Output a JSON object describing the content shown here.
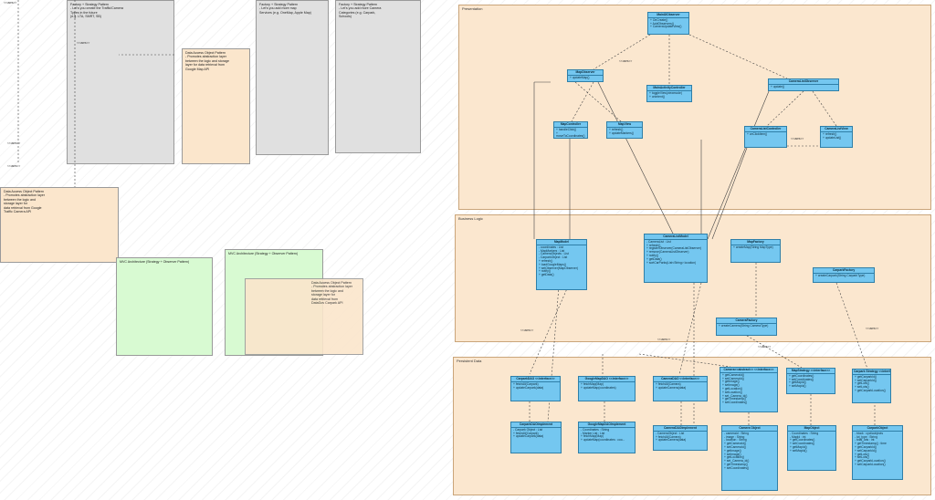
{
  "link_labels": {
    "top_left": "<<uses>>",
    "mid_left_1": "<<uses>>",
    "mid_left_2": "<<uses>>",
    "mid_left_3": "<<uses>>",
    "pres_1": "<<uses>>",
    "pres_2": "<<uses>>",
    "bl_1": "<<uses>>",
    "bl_2": "<<uses>>",
    "bl_3": "<<uses>>",
    "bl_4": "<<uses>>"
  },
  "notes": {
    "factory_1": "Factory + Strategy Pattern\n- Let's you create the Traffic/Camera\nTypes in the future\n(e.g. LTA, SMRT, SB)",
    "factory_2": "Factory + Strategy Pattern\n- Let's you add more map\nServices (e.g. OneMap, Apple Map)",
    "factory_3": "Factory + Strategy Pattern\n- Let's you add more Camera\nCategories (e.g. Carpark,\nSchools)",
    "dao_1": "Data Access Object Pattern\n- Promotes abstraction layer\nbetween the logic and storage\nlayer for data retrieval from\nGoogle Map API",
    "dao_2": "Data Access Object Pattern\n- Promotes abstraction layer\nbetween the logic and\nstorage layer for\ndata retrieval from Google\nTraffic Camera API",
    "dao_3": "Data Access Object Pattern\n- Promotes abstraction layer\nbetween the logic and\nstorage layer for\ndata retrieval from\nDataGov Carpark API",
    "mvc_1": "MVC Architecture (Strategy + Observer Pattern)",
    "mvc_2": "MVC Architecture (Strategy + Observer Pattern)"
  },
  "regions": {
    "presentation": "Presentation",
    "logic": "Business Logic",
    "persistent": "Persistent Data"
  },
  "classes": {
    "main_observer": {
      "name": "MainUIObserver",
      "body": "+ OnCreate()\n+ AddObservers()\n+ CameraUpdateView()"
    },
    "map_observer": {
      "name": "MapObserver",
      "body": "+ updateMap()"
    },
    "camlist_observer": {
      "name": "CameraListObserver",
      "body": "+ update()"
    },
    "mainactivity": {
      "name": "MainActivityController",
      "body": "+ toggleView(viewmode)\n+ onIntent()"
    },
    "map_controller": {
      "name": "MapController",
      "body": "+ handleClick()\n+ moveToCoordinates()"
    },
    "map_view": {
      "name": "MapView",
      "body": "+ refresh()\n+ updateMarkers()"
    },
    "camlist_controller": {
      "name": "CameraListController",
      "body": "+ onClickItem()"
    },
    "camlist_view": {
      "name": "CameraListView",
      "body": "+ refresh()\n+ updateList()"
    },
    "map_model": {
      "name": "MapModel",
      "body": "- coordinates : List\n- MapMarkers : List\n- CameraObjects : List\n- CarparkObject : List\n+ refresh()\n+ loadGoogleMaps()\n+ setObserver(MapObserver)\n+ notify()\n+ getData()"
    },
    "camlist_model": {
      "name": "CameraListModel",
      "body": "- CameraList : List\n+ refresh()\n+ registerObserver(CameraListObserver)\n+ remove(CameraListObserver)\n+ notify()\n+ getData()\n+ sortCarParks(List<String> location)"
    },
    "map_factory": {
      "name": "MapFactory",
      "body": "+ createMap(String MapType)"
    },
    "carpark_factory": {
      "name": "CarparkFactory",
      "body": "+ createCarpark(String CarparkType)"
    },
    "camera_factory": {
      "name": "CameraFactory",
      "body": "+ createCamera(String CameraType)"
    },
    "carpark_dao": {
      "name": "CarparkDAO <<interface>>",
      "body": "+ fetchAll(Carpark)\n+ updateCarpark(data)"
    },
    "googlemap_dao": {
      "name": "GoogleMapDAO <<interface>>",
      "body": "+ fetchMap(Map)\n+ updateMap(coordinates)"
    },
    "camera_dao": {
      "name": "CameraDAO <<interface>>",
      "body": "+ fetchAll(Camera)\n+ updateCamera(data)"
    },
    "camera_abstract": {
      "name": "Camera<<abstract>> <<interface>>",
      "body": "+ getCameraId()\n+ setCameraId()\n+ getImage()\n+ setImage()\n+ getLocation()\n+ setLocation()\n+ set_Camera_id()\n+ getTimestamp()\n+ setCoordinates()"
    },
    "map_strategy": {
      "name": "MapStrategy <<interface>>",
      "body": "+ getCoordinates()\n+ setCoordinates()\n+ getMapId()\n+ setMapId()"
    },
    "carpark_strategy": {
      "name": "Carpark Strategy <<interface>>",
      "body": "+ getCarparkId()\n+ setCarparkId()\n+ getLots()\n+ setLots()\n+ getCarparkLocation()"
    },
    "carpark_dao_impl": {
      "name": "CarparkDAOImplement",
      "body": "- Carpark Object : List\n+ fetchAll(Carpark)\n+ updateCarpark(data)"
    },
    "googlemap_dao_impl": {
      "name": "GoogleMapDAOImplement",
      "body": "- Coordinates : String\n- Marker List : List\n+ fetchMap(Map)\n+ updateMap(coordinates : coo..."
    },
    "camera_dao_impl": {
      "name": "CameraDAOImplement",
      "body": "- CameraObject : List\n+ fetchAll(Camera)\n+ updateCamera(data)"
    },
    "camera_object": {
      "name": "Camera Object",
      "body": "- cameraid : String\n- image : String\n- location : String\n+ getCameraId()\n+ setCameraId()\n+ getImage()\n+ setImage()\n+ getLocation()\n+ set_Camera_id()\n+ getTimestamp()\n+ setCoordinates()"
    },
    "map_object": {
      "name": "MapObject",
      "body": "- Coordinates : String\n- MapId : int\n+ getCoordinates()\n+ setCoordinates()\n+ getMapId()\n+ setMapId()"
    },
    "carpark_object": {
      "name": "CarparkObject",
      "body": "- block : cyclicobjects\n- lot_type : String\n- total_lots : int\n+ getTimestamp() : time\n+ getCarparkId()\n+ setCarparkId()\n+ getLots()\n+ setLots()\n+ getCarparkLocation()\n+ setCarparkLocation()"
    }
  }
}
